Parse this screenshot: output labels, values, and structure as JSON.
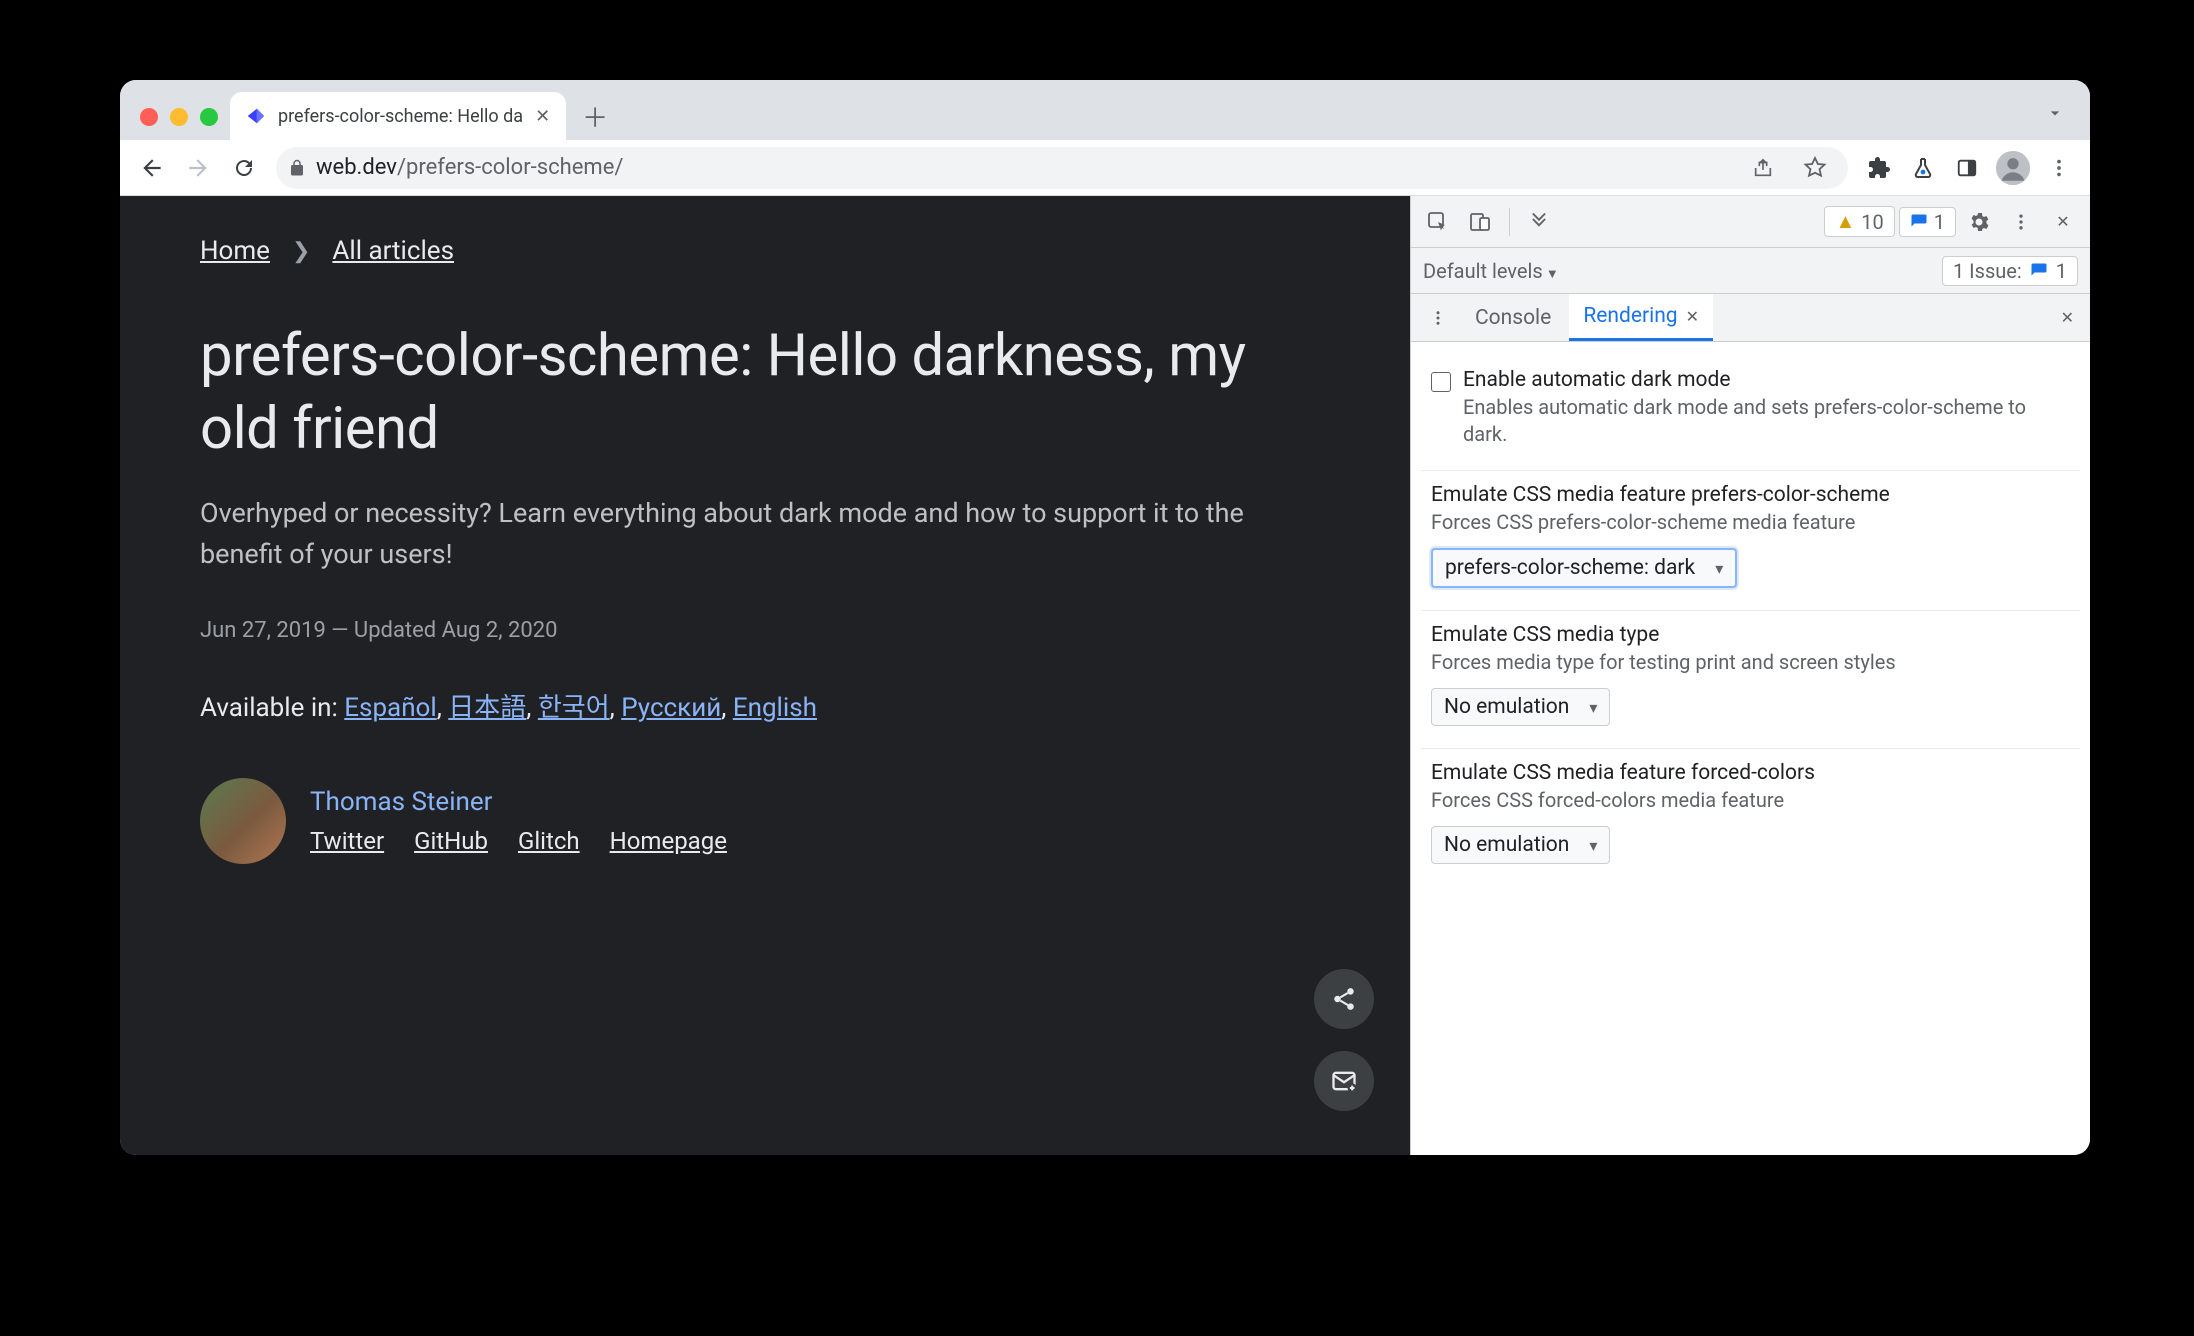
{
  "tab": {
    "title": "prefers-color-scheme: Hello da"
  },
  "url": {
    "domain": "web.dev",
    "path": "/prefers-color-scheme/"
  },
  "breadcrumbs": {
    "home": "Home",
    "all": "All articles"
  },
  "article": {
    "title": "prefers-color-scheme: Hello darkness, my old friend",
    "subtitle": "Overhyped or necessity? Learn everything about dark mode and how to support it to the benefit of your users!",
    "date": "Jun 27, 2019 — Updated Aug 2, 2020",
    "lang_lead": "Available in: ",
    "langs": [
      "Español",
      "日本語",
      "한국어",
      "Русский",
      "English"
    ],
    "author": {
      "name": "Thomas Steiner",
      "links": [
        "Twitter",
        "GitHub",
        "Glitch",
        "Homepage"
      ]
    }
  },
  "devtools": {
    "warn_count": "10",
    "info_count": "1",
    "levels": "Default levels",
    "issue_label": "1 Issue:",
    "issue_count": "1",
    "tabs": {
      "console": "Console",
      "rendering": "Rendering"
    },
    "sections": {
      "dark": {
        "label": "Enable automatic dark mode",
        "desc": "Enables automatic dark mode and sets prefers-color-scheme to dark."
      },
      "pcs": {
        "label": "Emulate CSS media feature prefers-color-scheme",
        "desc": "Forces CSS prefers-color-scheme media feature",
        "value": "prefers-color-scheme: dark"
      },
      "mediatype": {
        "label": "Emulate CSS media type",
        "desc": "Forces media type for testing print and screen styles",
        "value": "No emulation"
      },
      "forcedcolors": {
        "label": "Emulate CSS media feature forced-colors",
        "desc": "Forces CSS forced-colors media feature",
        "value": "No emulation"
      }
    }
  }
}
